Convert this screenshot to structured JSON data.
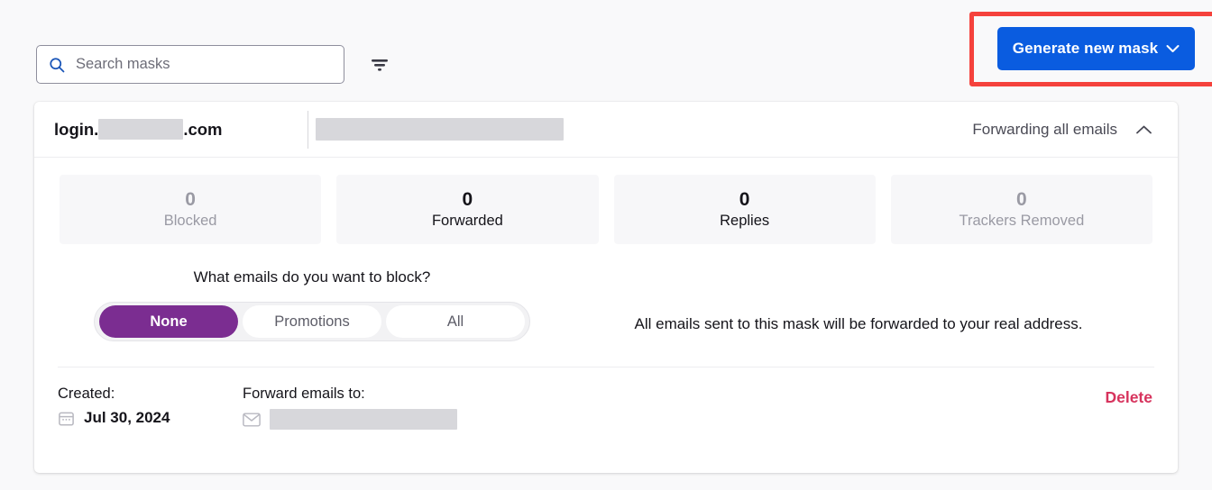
{
  "toolbar": {
    "search_placeholder": "Search masks",
    "search_value": "",
    "search_icon": "search-icon",
    "filter_icon": "filter-icon",
    "generate_button_label": "Generate new mask",
    "generate_chevron_icon": "chevron-down-icon",
    "accent_blue": "#0a5ce0",
    "annotation_color": "#f5423c"
  },
  "mask": {
    "label_prefix": "login.",
    "label_suffix": ".com",
    "label_redacted": true,
    "address_redacted": true,
    "status_text": "Forwarding all emails",
    "collapse_icon": "chevron-up-icon",
    "stats": [
      {
        "value": "0",
        "label": "Blocked",
        "muted": true
      },
      {
        "value": "0",
        "label": "Forwarded",
        "muted": false
      },
      {
        "value": "0",
        "label": "Replies",
        "muted": false
      },
      {
        "value": "0",
        "label": "Trackers Removed",
        "muted": true
      }
    ],
    "block_question": "What emails do you want to block?",
    "block_options": [
      {
        "label": "None",
        "active": true
      },
      {
        "label": "Promotions",
        "active": false
      },
      {
        "label": "All",
        "active": false
      }
    ],
    "block_description": "All emails sent to this mask will be forwarded to your real address.",
    "active_color": "#7b2d91",
    "footer": {
      "created_title": "Created:",
      "created_value": "Jul 30, 2024",
      "created_icon": "calendar-icon",
      "forward_title": "Forward emails to:",
      "forward_icon": "envelope-icon",
      "forward_redacted": true,
      "delete_label": "Delete",
      "delete_color": "#d7335d"
    }
  }
}
